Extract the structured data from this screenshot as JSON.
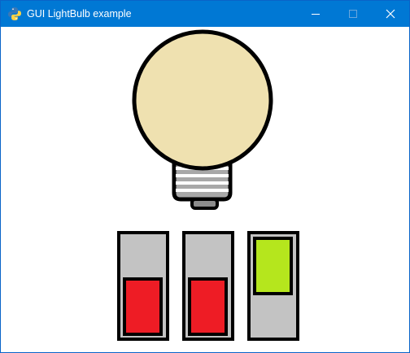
{
  "window": {
    "title": "GUI LightBulb example",
    "app_icon": "python-icon",
    "controls": [
      "minimize-icon",
      "maximize-icon",
      "close-icon"
    ]
  },
  "lightbulb": {
    "state": "off",
    "glass_color": "#efe1b0",
    "base_color": "#a8a8a8",
    "outline_color": "#000000"
  },
  "switches": [
    {
      "state": "off",
      "knob_position": "bottom",
      "color": "#ee1c25"
    },
    {
      "state": "off",
      "knob_position": "bottom",
      "color": "#ee1c25"
    },
    {
      "state": "on",
      "knob_position": "top",
      "color": "#b5e61d"
    }
  ],
  "switch_frame_color": "#c3c3c3"
}
